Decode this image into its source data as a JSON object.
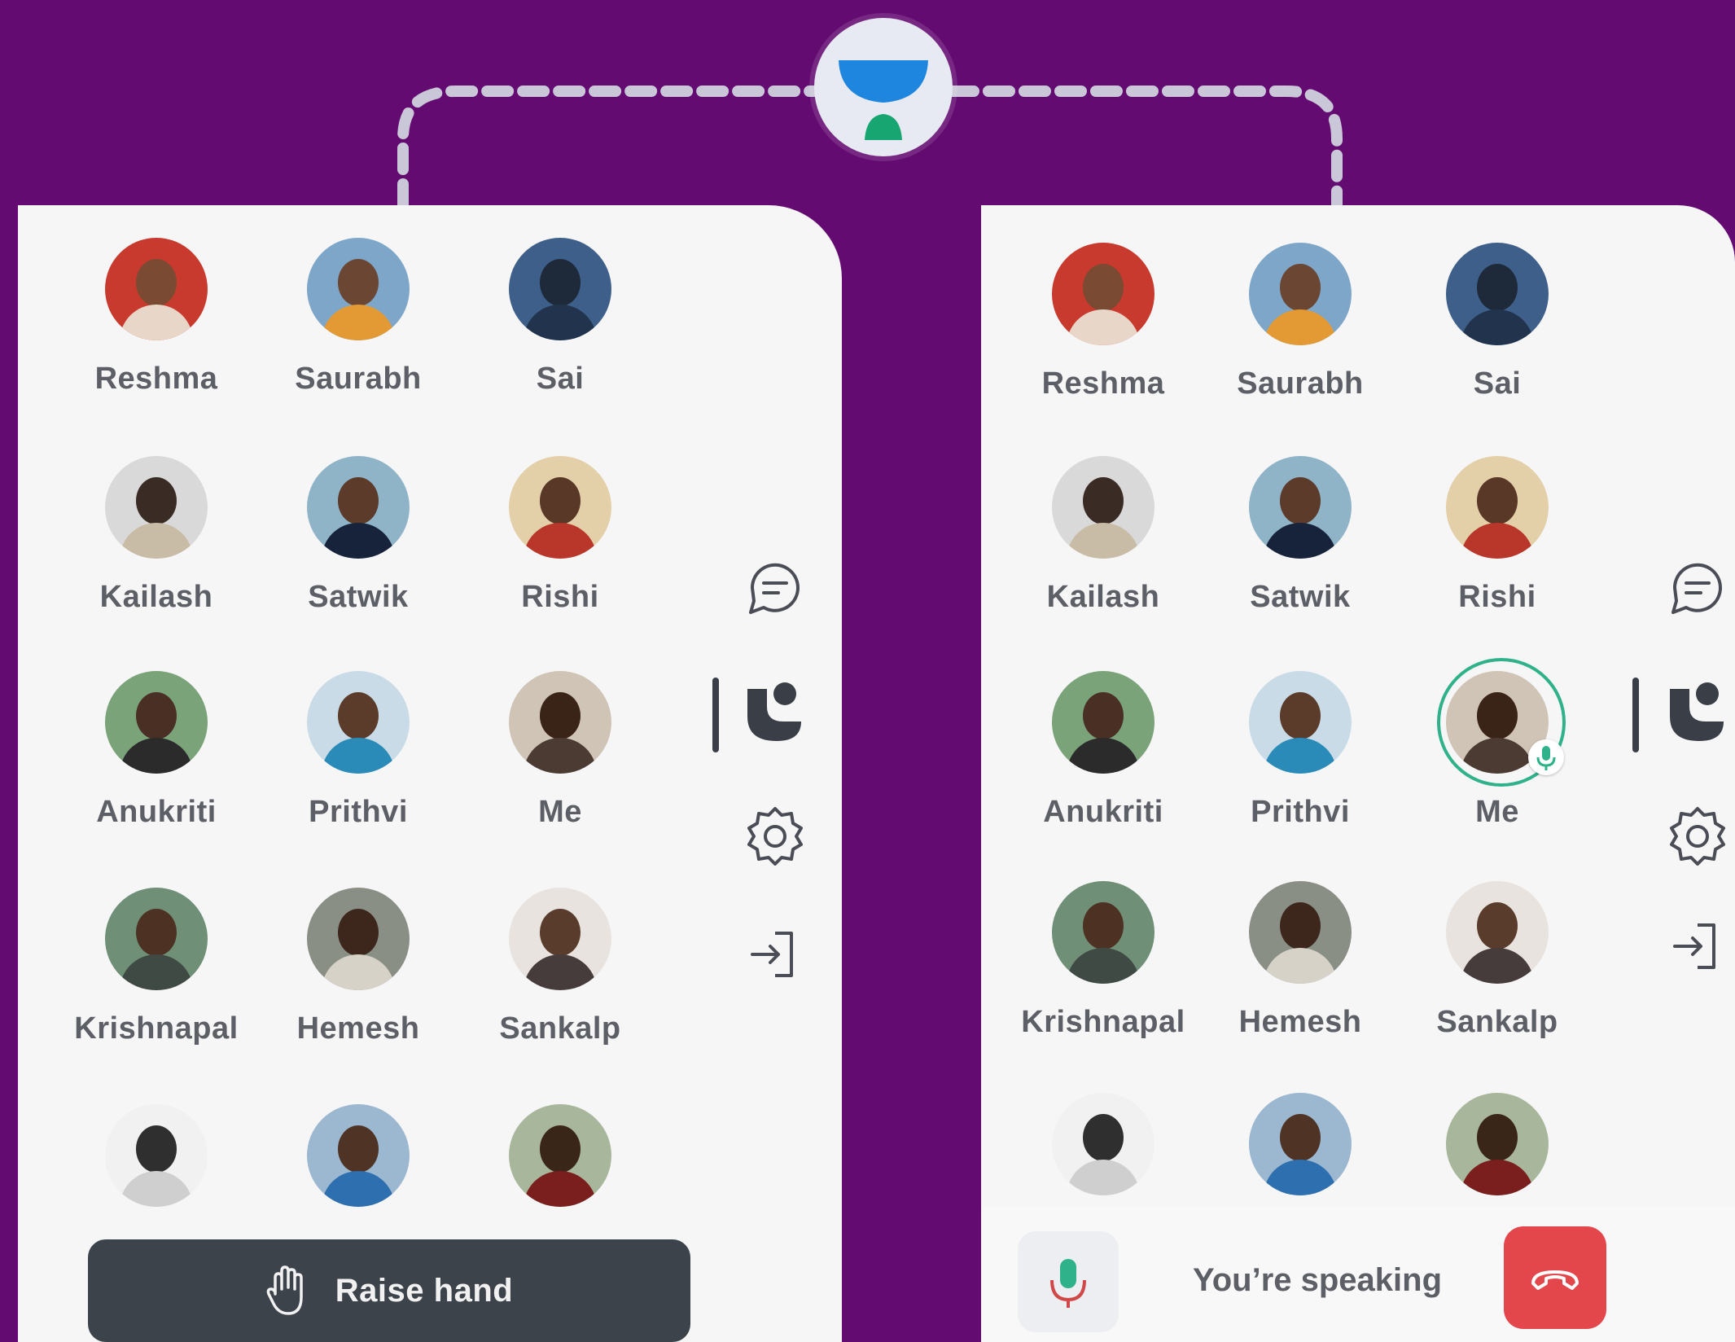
{
  "brand": {
    "logo_icon": "unacademy-logo-icon",
    "background": "#640b72",
    "accent_green": "#2fb28a",
    "end_call_red": "#e3474c"
  },
  "left_screen": {
    "participants": [
      {
        "name": "Reshma"
      },
      {
        "name": "Saurabh"
      },
      {
        "name": "Sai"
      },
      {
        "name": "Kailash"
      },
      {
        "name": "Satwik"
      },
      {
        "name": "Rishi"
      },
      {
        "name": "Anukriti"
      },
      {
        "name": "Prithvi"
      },
      {
        "name": "Me"
      },
      {
        "name": "Krishnapal"
      },
      {
        "name": "Hemesh"
      },
      {
        "name": "Sankalp"
      }
    ],
    "rail_icons": [
      "chat-icon",
      "participants-icon",
      "settings-icon",
      "leave-icon"
    ],
    "raise_hand": {
      "icon": "hand-icon",
      "label": "Raise hand"
    }
  },
  "right_screen": {
    "participants": [
      {
        "name": "Reshma"
      },
      {
        "name": "Saurabh"
      },
      {
        "name": "Sai"
      },
      {
        "name": "Kailash"
      },
      {
        "name": "Satwik"
      },
      {
        "name": "Rishi"
      },
      {
        "name": "Anukriti"
      },
      {
        "name": "Prithvi"
      },
      {
        "name": "Me",
        "speaking": true
      },
      {
        "name": "Krishnapal"
      },
      {
        "name": "Hemesh"
      },
      {
        "name": "Sankalp"
      }
    ],
    "rail_icons": [
      "chat-icon",
      "participants-icon",
      "settings-icon",
      "leave-icon"
    ],
    "status": {
      "text": "You’re speaking",
      "mic_icon": "microphone-icon",
      "end_icon": "end-call-icon"
    }
  }
}
